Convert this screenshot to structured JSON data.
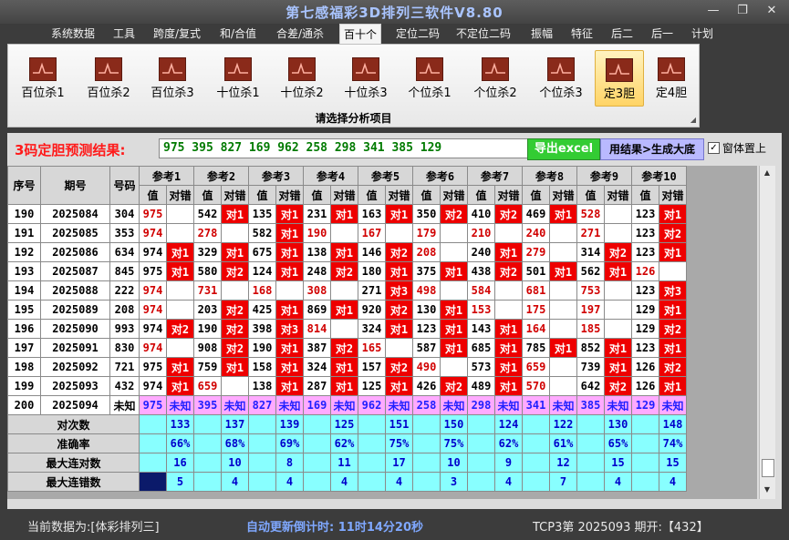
{
  "window": {
    "title": "第七感福彩3D排列三软件V8.80"
  },
  "menu": [
    "系统数据",
    "工具",
    "跨度/复式",
    "和/合值",
    "合差/通杀",
    "百十个",
    "定位二码",
    "不定位二码",
    "振幅",
    "特征",
    "后二",
    "后一",
    "计划"
  ],
  "active_menu_index": 5,
  "ribbon": {
    "buttons": [
      "百位杀1",
      "百位杀2",
      "百位杀3",
      "十位杀1",
      "十位杀2",
      "十位杀3",
      "个位杀1",
      "个位杀2",
      "个位杀3",
      "定3胆",
      "定4胆"
    ],
    "selected_index": 9,
    "caption": "请选择分析项目"
  },
  "prediction": {
    "label": "3码定胆预测结果:",
    "value": "975 395 827 169 962 258 298 341 385 129",
    "export_button": "导出excel",
    "apply_button": "用结果>生成大底",
    "window_topmost_label": "窗体置上",
    "window_topmost_checked": true
  },
  "table": {
    "col_headers": {
      "seq": "序号",
      "period": "期号",
      "number": "号码",
      "value": "值",
      "result": "对错"
    },
    "ref_headers": [
      "参考1",
      "参考2",
      "参考3",
      "参考4",
      "参考5",
      "参考6",
      "参考7",
      "参考8",
      "参考9",
      "参考10"
    ],
    "rows": [
      {
        "seq": "190",
        "period": "2025084",
        "number": "304",
        "cells": [
          [
            "975",
            ""
          ],
          [
            "542",
            "对1"
          ],
          [
            "135",
            "对1"
          ],
          [
            "231",
            "对1"
          ],
          [
            "163",
            "对1"
          ],
          [
            "350",
            "对2"
          ],
          [
            "410",
            "对2"
          ],
          [
            "469",
            "对1"
          ],
          [
            "528",
            ""
          ],
          [
            "123",
            "对1"
          ]
        ]
      },
      {
        "seq": "191",
        "period": "2025085",
        "number": "353",
        "cells": [
          [
            "974",
            ""
          ],
          [
            "278",
            ""
          ],
          [
            "582",
            "对1"
          ],
          [
            "190",
            ""
          ],
          [
            "167",
            ""
          ],
          [
            "179",
            ""
          ],
          [
            "210",
            ""
          ],
          [
            "240",
            ""
          ],
          [
            "271",
            ""
          ],
          [
            "123",
            "对2"
          ]
        ]
      },
      {
        "seq": "192",
        "period": "2025086",
        "number": "634",
        "cells": [
          [
            "974",
            "对1"
          ],
          [
            "329",
            "对1"
          ],
          [
            "675",
            "对1"
          ],
          [
            "138",
            "对1"
          ],
          [
            "146",
            "对2"
          ],
          [
            "208",
            ""
          ],
          [
            "240",
            "对1"
          ],
          [
            "279",
            ""
          ],
          [
            "314",
            "对2"
          ],
          [
            "123",
            "对1"
          ]
        ]
      },
      {
        "seq": "193",
        "period": "2025087",
        "number": "845",
        "cells": [
          [
            "975",
            "对1"
          ],
          [
            "580",
            "对2"
          ],
          [
            "124",
            "对1"
          ],
          [
            "248",
            "对2"
          ],
          [
            "180",
            "对1"
          ],
          [
            "375",
            "对1"
          ],
          [
            "438",
            "对2"
          ],
          [
            "501",
            "对1"
          ],
          [
            "562",
            "对1"
          ],
          [
            "126",
            ""
          ]
        ]
      },
      {
        "seq": "194",
        "period": "2025088",
        "number": "222",
        "cells": [
          [
            "974",
            ""
          ],
          [
            "731",
            ""
          ],
          [
            "168",
            ""
          ],
          [
            "308",
            ""
          ],
          [
            "271",
            "对3"
          ],
          [
            "498",
            ""
          ],
          [
            "584",
            ""
          ],
          [
            "681",
            ""
          ],
          [
            "753",
            ""
          ],
          [
            "123",
            "对3"
          ]
        ]
      },
      {
        "seq": "195",
        "period": "2025089",
        "number": "208",
        "cells": [
          [
            "974",
            ""
          ],
          [
            "203",
            "对2"
          ],
          [
            "425",
            "对1"
          ],
          [
            "869",
            "对1"
          ],
          [
            "920",
            "对2"
          ],
          [
            "130",
            "对1"
          ],
          [
            "153",
            ""
          ],
          [
            "175",
            ""
          ],
          [
            "197",
            ""
          ],
          [
            "129",
            "对1"
          ]
        ]
      },
      {
        "seq": "196",
        "period": "2025090",
        "number": "993",
        "cells": [
          [
            "974",
            "对2"
          ],
          [
            "190",
            "对2"
          ],
          [
            "398",
            "对3"
          ],
          [
            "814",
            ""
          ],
          [
            "324",
            "对1"
          ],
          [
            "123",
            "对1"
          ],
          [
            "143",
            "对1"
          ],
          [
            "164",
            ""
          ],
          [
            "185",
            ""
          ],
          [
            "129",
            "对2"
          ]
        ]
      },
      {
        "seq": "197",
        "period": "2025091",
        "number": "830",
        "cells": [
          [
            "974",
            ""
          ],
          [
            "908",
            "对2"
          ],
          [
            "190",
            "对1"
          ],
          [
            "387",
            "对2"
          ],
          [
            "165",
            ""
          ],
          [
            "587",
            "对1"
          ],
          [
            "685",
            "对1"
          ],
          [
            "785",
            "对1"
          ],
          [
            "852",
            "对1"
          ],
          [
            "123",
            "对1"
          ]
        ]
      },
      {
        "seq": "198",
        "period": "2025092",
        "number": "721",
        "cells": [
          [
            "975",
            "对1"
          ],
          [
            "759",
            "对1"
          ],
          [
            "158",
            "对1"
          ],
          [
            "324",
            "对1"
          ],
          [
            "157",
            "对2"
          ],
          [
            "490",
            ""
          ],
          [
            "573",
            "对1"
          ],
          [
            "659",
            ""
          ],
          [
            "739",
            "对1"
          ],
          [
            "126",
            "对2"
          ]
        ]
      },
      {
        "seq": "199",
        "period": "2025093",
        "number": "432",
        "cells": [
          [
            "974",
            "对1"
          ],
          [
            "659",
            ""
          ],
          [
            "138",
            "对1"
          ],
          [
            "287",
            "对1"
          ],
          [
            "125",
            "对1"
          ],
          [
            "426",
            "对2"
          ],
          [
            "489",
            "对1"
          ],
          [
            "570",
            ""
          ],
          [
            "642",
            "对2"
          ],
          [
            "126",
            "对1"
          ]
        ]
      },
      {
        "seq": "200",
        "period": "2025094",
        "number": "未知",
        "cells": [
          [
            "975",
            "未知"
          ],
          [
            "395",
            "未知"
          ],
          [
            "827",
            "未知"
          ],
          [
            "169",
            "未知"
          ],
          [
            "962",
            "未知"
          ],
          [
            "258",
            "未知"
          ],
          [
            "298",
            "未知"
          ],
          [
            "341",
            "未知"
          ],
          [
            "385",
            "未知"
          ],
          [
            "129",
            "未知"
          ]
        ]
      }
    ],
    "stats": [
      {
        "label": "对次数",
        "values": [
          "133",
          "137",
          "139",
          "125",
          "151",
          "150",
          "124",
          "122",
          "130",
          "148"
        ]
      },
      {
        "label": "准确率",
        "values": [
          "66%",
          "68%",
          "69%",
          "62%",
          "75%",
          "75%",
          "62%",
          "61%",
          "65%",
          "74%"
        ]
      },
      {
        "label": "最大连对数",
        "values": [
          "16",
          "10",
          "8",
          "11",
          "17",
          "10",
          "9",
          "12",
          "15",
          "15"
        ]
      },
      {
        "label": "最大连错数",
        "values": [
          "5",
          "4",
          "4",
          "4",
          "4",
          "3",
          "4",
          "7",
          "4",
          "4"
        ]
      }
    ]
  },
  "status": {
    "current_data": "当前数据为:[体彩排列三]",
    "countdown": "自动更新倒计时: 11时14分20秒",
    "latest": "TCP3第 2025093 期开:【432】"
  },
  "colors": {
    "hit": "#ee0000",
    "miss": "#d10000",
    "future": "#ffaaff",
    "stats": "#88ffff",
    "title": "#a9c4ff",
    "prediction": "#007a00"
  }
}
